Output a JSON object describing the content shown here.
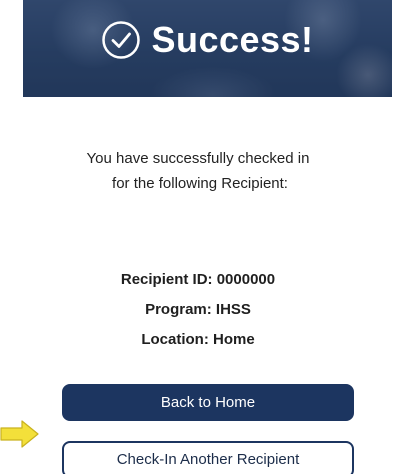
{
  "banner": {
    "title": "Success!",
    "icon": "check-circle-icon"
  },
  "message": {
    "line1": "You have successfully checked in",
    "line2": "for the following Recipient:"
  },
  "details": {
    "recipient_id": "Recipient ID: 0000000",
    "program": "Program: IHSS",
    "location": "Location: Home"
  },
  "buttons": {
    "back_home": "Back to Home",
    "check_in_another": "Check-In Another Recipient"
  },
  "annotation": {
    "icon": "arrow-right-icon",
    "color": "#f3e03a"
  },
  "colors": {
    "primary": "#1c3560",
    "banner_bg": "#2b4366"
  }
}
